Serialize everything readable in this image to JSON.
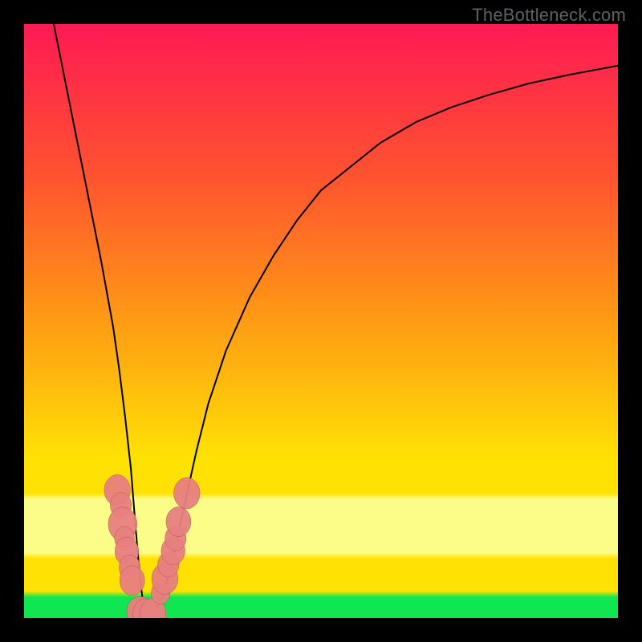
{
  "watermark": {
    "text": "TheBottleneck.com"
  },
  "colors": {
    "frame": "#000000",
    "grad_top": "#ff1a54",
    "grad_mid1": "#ff5130",
    "grad_mid2": "#ff9516",
    "grad_mid3": "#ffe104",
    "grad_band": "#fbfd88",
    "grad_green": "#10e650",
    "curve": "#000000",
    "marker_fill": "#e88080",
    "marker_stroke": "#b05252"
  },
  "chart_data": {
    "type": "line",
    "title": "",
    "xlabel": "",
    "ylabel": "",
    "xlim": [
      0,
      100
    ],
    "ylim": [
      0,
      100
    ],
    "grid": false,
    "series": [
      {
        "name": "bottleneck-curve",
        "x": [
          5,
          7,
          9,
          11,
          13,
          15,
          16,
          17,
          18,
          18.8,
          19.5,
          20.2,
          21,
          22,
          23.5,
          25,
          27,
          29,
          31,
          34,
          38,
          42,
          46,
          50,
          55,
          60,
          66,
          72,
          78,
          85,
          92,
          100
        ],
        "y": [
          100,
          90,
          80,
          70,
          60,
          49,
          42,
          34,
          25,
          15,
          7,
          1,
          0.5,
          1,
          4,
          10,
          19,
          28,
          36,
          45,
          54,
          61,
          67,
          72,
          76,
          80,
          83.5,
          86,
          88,
          90,
          91.5,
          93
        ]
      }
    ],
    "markers": [
      {
        "x": 15.7,
        "y": 21.5,
        "r": 2.1
      },
      {
        "x": 16.3,
        "y": 19.0,
        "r": 1.7
      },
      {
        "x": 16.6,
        "y": 15.8,
        "r": 2.3
      },
      {
        "x": 16.9,
        "y": 13.4,
        "r": 1.6
      },
      {
        "x": 17.3,
        "y": 11.2,
        "r": 1.9
      },
      {
        "x": 17.8,
        "y": 8.5,
        "r": 1.7
      },
      {
        "x": 18.2,
        "y": 6.3,
        "r": 2.0
      },
      {
        "x": 19.5,
        "y": 1.0,
        "r": 2.1
      },
      {
        "x": 20.5,
        "y": 0.6,
        "r": 2.1
      },
      {
        "x": 21.7,
        "y": 0.7,
        "r": 2.1
      },
      {
        "x": 23.0,
        "y": 4.2,
        "r": 1.5
      },
      {
        "x": 23.7,
        "y": 6.6,
        "r": 2.1
      },
      {
        "x": 24.3,
        "y": 9.0,
        "r": 1.7
      },
      {
        "x": 25.1,
        "y": 11.3,
        "r": 1.9
      },
      {
        "x": 25.5,
        "y": 13.4,
        "r": 1.7
      },
      {
        "x": 26.0,
        "y": 16.2,
        "r": 2.0
      },
      {
        "x": 27.4,
        "y": 21.0,
        "r": 2.1
      }
    ],
    "gradient_stops": [
      {
        "offset": 0.0,
        "key": "grad_top"
      },
      {
        "offset": 0.25,
        "key": "grad_mid1"
      },
      {
        "offset": 0.48,
        "key": "grad_mid2"
      },
      {
        "offset": 0.73,
        "key": "grad_mid3"
      },
      {
        "offset": 0.79,
        "key": "grad_mid3"
      },
      {
        "offset": 0.8,
        "key": "grad_band"
      },
      {
        "offset": 0.89,
        "key": "grad_band"
      },
      {
        "offset": 0.9,
        "key": "grad_mid3"
      },
      {
        "offset": 0.955,
        "key": "grad_mid3"
      },
      {
        "offset": 0.965,
        "key": "grad_green"
      },
      {
        "offset": 1.0,
        "key": "grad_green"
      }
    ]
  }
}
